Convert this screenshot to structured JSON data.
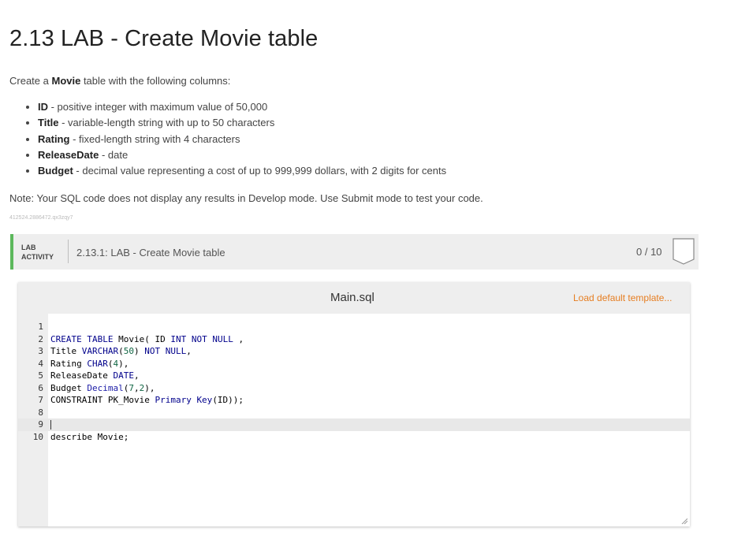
{
  "page": {
    "title": "2.13 LAB - Create Movie table",
    "intro_prefix": "Create a ",
    "intro_bold": "Movie",
    "intro_suffix": " table with the following columns:",
    "columns": [
      {
        "name": "ID",
        "desc": " - positive integer with maximum value of 50,000"
      },
      {
        "name": "Title",
        "desc": " - variable-length string with up to 50 characters"
      },
      {
        "name": "Rating",
        "desc": " - fixed-length string with 4 characters"
      },
      {
        "name": "ReleaseDate",
        "desc": " - date"
      },
      {
        "name": "Budget",
        "desc": " - decimal value representing a cost of up to 999,999 dollars, with 2 digits for cents"
      }
    ],
    "note": "Note: Your SQL code does not display any results in Develop mode. Use Submit mode to test your code.",
    "tiny_id": "412524.2886472.qx3zqy7"
  },
  "lab": {
    "tag_line1": "LAB",
    "tag_line2": "ACTIVITY",
    "name": "2.13.1: LAB - Create Movie table",
    "score": "0 / 10"
  },
  "editor": {
    "filename": "Main.sql",
    "load_template": "Load default template...",
    "active_line": 9,
    "lines": [
      {
        "n": "1",
        "code": ""
      },
      {
        "n": "2",
        "code": "CREATE TABLE Movie( ID INT NOT NULL ,"
      },
      {
        "n": "3",
        "code": "Title VARCHAR(50) NOT NULL,"
      },
      {
        "n": "4",
        "code": "Rating CHAR(4),"
      },
      {
        "n": "5",
        "code": "ReleaseDate DATE,"
      },
      {
        "n": "6",
        "code": "Budget Decimal(7,2),"
      },
      {
        "n": "7",
        "code": "CONSTRAINT PK_Movie Primary Key(ID));"
      },
      {
        "n": "8",
        "code": ""
      },
      {
        "n": "9",
        "code": ""
      },
      {
        "n": "10",
        "code": "describe Movie;"
      }
    ]
  },
  "colors": {
    "accent_green": "#5cb85c",
    "link_orange": "#e67e22",
    "keyword_blue": "#00008b",
    "number_green": "#116644"
  },
  "icons": {
    "badge": "badge-icon",
    "resize": "resize-handle-icon"
  }
}
